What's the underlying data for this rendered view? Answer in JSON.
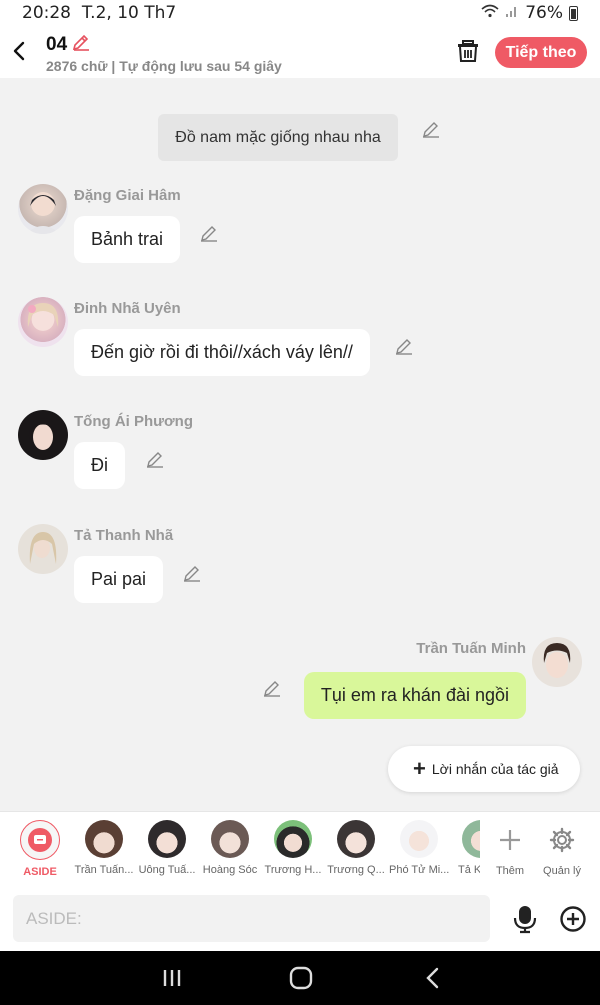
{
  "status": {
    "time": "20:28",
    "date": "T.2, 10 Th7",
    "battery": "76%"
  },
  "header": {
    "title": "04",
    "subtitle": "2876 chữ | Tự động lưu sau 54 giây",
    "next_label": "Tiếp theo"
  },
  "colors": {
    "accent": "#ef5a65",
    "my_bubble": "#d9f79a",
    "bubble": "#ffffff",
    "narration": "#e5e5e5"
  },
  "chat": {
    "narration": "Đồ nam mặc giống nhau nha",
    "messages": [
      {
        "name": "Đặng Giai Hâm",
        "text": "Bảnh trai"
      },
      {
        "name": "Đinh Nhã Uyên",
        "text": "Đến giờ rồi đi thôi//xách váy lên//"
      },
      {
        "name": "Tống Ái Phương",
        "text": "Đi"
      },
      {
        "name": "Tả Thanh Nhã",
        "text": "Pai pai"
      }
    ],
    "my_message": {
      "name": "Trần Tuấn Minh",
      "text": "Tụi em ra khán đài ngồi"
    },
    "author_note": "Lời nhắn của tác giả"
  },
  "characters": {
    "aside_label": "ASIDE",
    "items": [
      {
        "label": "Trần Tuấn..."
      },
      {
        "label": "Uông Tuấ..."
      },
      {
        "label": "Hoàng Sóc"
      },
      {
        "label": "Trương H..."
      },
      {
        "label": "Trương Q..."
      },
      {
        "label": "Phó Tử Mi..."
      },
      {
        "label": "Tả K"
      }
    ],
    "more_label": "Thêm",
    "manage_label": "Quản lý"
  },
  "input": {
    "placeholder": "ASIDE:"
  }
}
